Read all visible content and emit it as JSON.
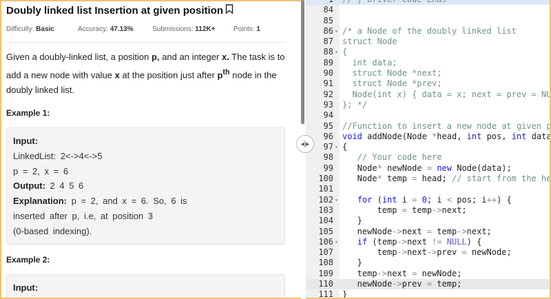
{
  "problem": {
    "title": "Doubly linked list Insertion at given position",
    "meta": {
      "difficulty_label": "Difficulty:",
      "difficulty": "Basic",
      "accuracy_label": "Accuracy:",
      "accuracy": "47.13%",
      "submissions_label": "Submissions:",
      "submissions": "112K+",
      "points_label": "Points:",
      "points": "1"
    },
    "desc": {
      "p1": "Given a doubly-linked list, a position ",
      "p": "p,",
      "p2": " and an integer ",
      "x": "x.",
      "p3": " The task is to add a new node with value ",
      "x2": "x",
      "p4": " at the position just after ",
      "p_sup_base": "p",
      "sup": "th",
      "p5": " node in the doubly linked list."
    },
    "example1": {
      "heading": "Example 1:",
      "input_label": "Input:",
      "linked_list": "LinkedList: 2<->4<->5",
      "params": "p = 2, x = 6",
      "output_label": "Output:",
      "output": " 2 4 5 6",
      "explanation_label": "Explanation:",
      "explanation_1": " p = 2, and x = 6. So, 6 is",
      "explanation_2": "inserted after p, i.e, at position 3",
      "explanation_3": "(0-based indexing)."
    },
    "example2": {
      "heading": "Example 2:",
      "input_label": "Input:"
    }
  },
  "editor": {
    "lines": [
      {
        "n": "1",
        "sel": true,
        "tokens": [
          {
            "c": "c",
            "t": "// } Driver Code Ends"
          }
        ]
      },
      {
        "n": "84",
        "tokens": []
      },
      {
        "n": "85",
        "tokens": []
      },
      {
        "n": "86",
        "fold": true,
        "tokens": [
          {
            "c": "c",
            "t": "/* a Node of the doubly linked list"
          }
        ]
      },
      {
        "n": "87",
        "tokens": [
          {
            "c": "c",
            "t": "struct Node"
          }
        ]
      },
      {
        "n": "88",
        "fold": true,
        "tokens": [
          {
            "c": "c",
            "t": "{"
          }
        ]
      },
      {
        "n": "89",
        "tokens": [
          {
            "c": "c",
            "t": "  int data;"
          }
        ]
      },
      {
        "n": "90",
        "tokens": [
          {
            "c": "c",
            "t": "  struct Node *next;"
          }
        ]
      },
      {
        "n": "91",
        "tokens": [
          {
            "c": "c",
            "t": "  struct Node *prev;"
          }
        ]
      },
      {
        "n": "92",
        "tokens": [
          {
            "c": "c",
            "t": "  Node(int x) { data = x; next = prev = NULL; }"
          }
        ]
      },
      {
        "n": "93",
        "tokens": [
          {
            "c": "c",
            "t": "}; */"
          }
        ]
      },
      {
        "n": "94",
        "tokens": []
      },
      {
        "n": "95",
        "tokens": [
          {
            "c": "c",
            "t": "//Function to insert a new node at given position"
          }
        ]
      },
      {
        "n": "96",
        "tokens": [
          {
            "c": "k",
            "t": "void"
          },
          {
            "c": "",
            "t": " addNode(Node "
          },
          {
            "c": "o",
            "t": "*"
          },
          {
            "c": "",
            "t": "head, "
          },
          {
            "c": "k",
            "t": "int"
          },
          {
            "c": "",
            "t": " pos, "
          },
          {
            "c": "k",
            "t": "int"
          },
          {
            "c": "",
            "t": " data)"
          }
        ]
      },
      {
        "n": "97",
        "fold": true,
        "tokens": [
          {
            "c": "",
            "t": "{"
          }
        ]
      },
      {
        "n": "98",
        "tokens": [
          {
            "c": "c",
            "t": "   // Your code here"
          }
        ]
      },
      {
        "n": "99",
        "tokens": [
          {
            "c": "",
            "t": "   Node"
          },
          {
            "c": "o",
            "t": "*"
          },
          {
            "c": "",
            "t": " newNode "
          },
          {
            "c": "o",
            "t": "="
          },
          {
            "c": "",
            "t": " "
          },
          {
            "c": "k",
            "t": "new"
          },
          {
            "c": "",
            "t": " Node(data);"
          }
        ]
      },
      {
        "n": "100",
        "tokens": [
          {
            "c": "",
            "t": "   Node"
          },
          {
            "c": "o",
            "t": "*"
          },
          {
            "c": "",
            "t": " temp "
          },
          {
            "c": "o",
            "t": "="
          },
          {
            "c": "",
            "t": " head; "
          },
          {
            "c": "c",
            "t": "// start from the head"
          }
        ]
      },
      {
        "n": "101",
        "tokens": []
      },
      {
        "n": "102",
        "fold": true,
        "tokens": [
          {
            "c": "",
            "t": "   "
          },
          {
            "c": "k",
            "t": "for"
          },
          {
            "c": "",
            "t": " ("
          },
          {
            "c": "k",
            "t": "int"
          },
          {
            "c": "",
            "t": " i "
          },
          {
            "c": "o",
            "t": "="
          },
          {
            "c": "",
            "t": " "
          },
          {
            "c": "k",
            "t": "0"
          },
          {
            "c": "",
            "t": "; i "
          },
          {
            "c": "o",
            "t": "<"
          },
          {
            "c": "",
            "t": " pos; i"
          },
          {
            "c": "o",
            "t": "++"
          },
          {
            "c": "",
            "t": ") {"
          }
        ]
      },
      {
        "n": "103",
        "tokens": [
          {
            "c": "",
            "t": "       temp "
          },
          {
            "c": "o",
            "t": "="
          },
          {
            "c": "",
            "t": " temp"
          },
          {
            "c": "o",
            "t": "->"
          },
          {
            "c": "",
            "t": "next;"
          }
        ]
      },
      {
        "n": "104",
        "tokens": [
          {
            "c": "",
            "t": "   }"
          }
        ]
      },
      {
        "n": "105",
        "tokens": [
          {
            "c": "",
            "t": "   newNode"
          },
          {
            "c": "o",
            "t": "->"
          },
          {
            "c": "",
            "t": "next "
          },
          {
            "c": "o",
            "t": "="
          },
          {
            "c": "",
            "t": " temp"
          },
          {
            "c": "o",
            "t": "->"
          },
          {
            "c": "",
            "t": "next;"
          }
        ]
      },
      {
        "n": "106",
        "fold": true,
        "tokens": [
          {
            "c": "",
            "t": "   "
          },
          {
            "c": "k",
            "t": "if"
          },
          {
            "c": "",
            "t": " (temp"
          },
          {
            "c": "o",
            "t": "->"
          },
          {
            "c": "",
            "t": "next "
          },
          {
            "c": "o",
            "t": "!="
          },
          {
            "c": "",
            "t": " "
          },
          {
            "c": "n",
            "t": "NULL"
          },
          {
            "c": "",
            "t": ") {"
          }
        ]
      },
      {
        "n": "107",
        "tokens": [
          {
            "c": "",
            "t": "       temp"
          },
          {
            "c": "o",
            "t": "->"
          },
          {
            "c": "",
            "t": "next"
          },
          {
            "c": "o",
            "t": "->"
          },
          {
            "c": "",
            "t": "prev "
          },
          {
            "c": "o",
            "t": "="
          },
          {
            "c": "",
            "t": " newNode;"
          }
        ]
      },
      {
        "n": "108",
        "tokens": [
          {
            "c": "",
            "t": "   }"
          }
        ]
      },
      {
        "n": "109",
        "tokens": [
          {
            "c": "",
            "t": "   temp"
          },
          {
            "c": "o",
            "t": "->"
          },
          {
            "c": "",
            "t": "next "
          },
          {
            "c": "o",
            "t": "="
          },
          {
            "c": "",
            "t": " newNode;"
          }
        ]
      },
      {
        "n": "110",
        "hl": true,
        "tokens": [
          {
            "c": "",
            "t": "   newNode"
          },
          {
            "c": "o",
            "t": "->"
          },
          {
            "c": "",
            "t": "prev "
          },
          {
            "c": "o",
            "t": "="
          },
          {
            "c": "",
            "t": " temp;"
          }
        ]
      },
      {
        "n": "111",
        "tokens": [
          {
            "c": "",
            "t": "}"
          }
        ]
      }
    ]
  }
}
